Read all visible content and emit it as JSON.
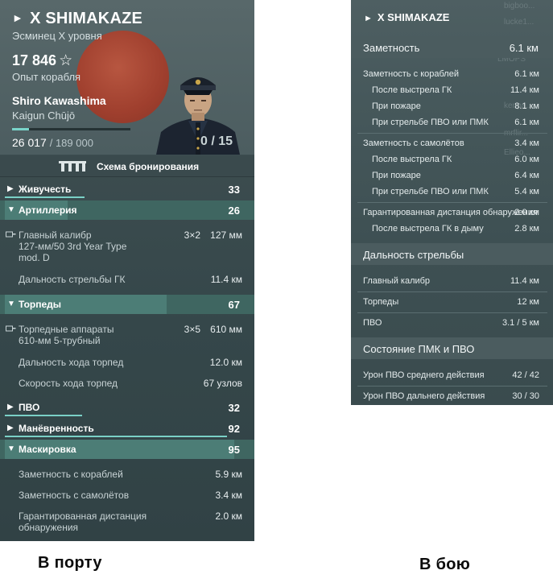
{
  "port": {
    "ship_name": "X SHIMAKAZE",
    "ship_subtitle": "Эсминец X уровня",
    "ship_xp": "17 846",
    "ship_xp_label": "Опыт корабля",
    "commander_name": "Shiro Kawashima",
    "commander_rank": "Kaigun Chūjō",
    "commander_xp": "26 017",
    "commander_xp_max": "/ 189 000",
    "commander_xp_progress": 0.14,
    "commander_skills": "0 / 15",
    "armor_scheme_label": "Схема бронирования",
    "sections": {
      "survivability": {
        "label": "Живучесть",
        "value": "33",
        "progress": 0.33
      },
      "artillery": {
        "label": "Артиллерия",
        "value": "26",
        "progress": 0.26
      },
      "torpedoes": {
        "label": "Торпеды",
        "value": "67",
        "progress": 0.67
      },
      "aa": {
        "label": "ПВО",
        "value": "32",
        "progress": 0.32
      },
      "maneuverability": {
        "label": "Манёвренность",
        "value": "92",
        "progress": 0.92
      },
      "concealment": {
        "label": "Маскировка",
        "value": "95",
        "progress": 0.95
      }
    },
    "artillery": {
      "main_battery_line1": "Главный калибр",
      "main_battery_line2": "127-мм/50 3rd Year Type",
      "main_battery_line3": "mod. D",
      "main_battery_count": "3×2",
      "main_battery_caliber": "127 мм",
      "range_label": "Дальность стрельбы ГК",
      "range_value": "11.4 км"
    },
    "torpedoes": {
      "launchers_line1": "Торпедные аппараты",
      "launchers_line2": "610-мм 5-трубный",
      "launchers_count": "3×5",
      "launchers_caliber": "610 мм",
      "range_label": "Дальность хода торпед",
      "range_value": "12.0 км",
      "speed_label": "Скорость хода торпед",
      "speed_value": "67 узлов"
    },
    "concealment": {
      "by_sea_label": "Заметность с кораблей",
      "by_sea_value": "5.9 км",
      "by_air_label": "Заметность с самолётов",
      "by_air_value": "3.4 км",
      "guaranteed_line1": "Гарантированная дистанция",
      "guaranteed_line2": "обнаружения",
      "guaranteed_value": "2.0 км"
    }
  },
  "battle": {
    "ship_name": "X SHIMAKAZE",
    "ghost_text": [
      "bigboo...",
      "lucke1...",
      "LMOPS",
      "kenpa...",
      "mrflir...",
      "Ellieo..."
    ],
    "detectability": {
      "label": "Заметность",
      "value": "6.1 км"
    },
    "by_ships": {
      "label": "Заметность с кораблей",
      "value": "6.1 км"
    },
    "after_gk": {
      "label": "После выстрела ГК",
      "value": "11.4 км"
    },
    "on_fire": {
      "label": "При пожаре",
      "value": "8.1 км"
    },
    "aa_pmk": {
      "label": "При стрельбе ПВО или ПМК",
      "value": "6.1 км"
    },
    "by_air": {
      "label": "Заметность с самолётов",
      "value": "3.4 км"
    },
    "air_after_gk": {
      "label": "После выстрела ГК",
      "value": "6.0 км"
    },
    "air_on_fire": {
      "label": "При пожаре",
      "value": "6.4 км"
    },
    "air_aa_pmk": {
      "label": "При стрельбе ПВО или ПМК",
      "value": "5.4 км"
    },
    "guaranteed": {
      "label": "Гарантированная дистанция обнаружения",
      "value": "2.0 км"
    },
    "smoke_after_gk": {
      "label": "После выстрела ГК в дыму",
      "value": "2.8 км"
    },
    "range_header": "Дальность стрельбы",
    "main_battery": {
      "label": "Главный калибр",
      "value": "11.4 км"
    },
    "torpedoes": {
      "label": "Торпеды",
      "value": "12 км"
    },
    "aa": {
      "label": "ПВО",
      "value": "3.1 / 5 км"
    },
    "state_header": "Состояние ПМК и ПВО",
    "aa_mid": {
      "label": "Урон ПВО среднего действия",
      "value": "42 / 42"
    },
    "aa_long": {
      "label": "Урон ПВО дальнего действия",
      "value": "30 / 30"
    }
  },
  "captions": {
    "port": "В порту",
    "battle": "В бою"
  },
  "colors": {
    "accent": "#7ad0c6",
    "open_section": "#3f6661",
    "sun": "#a63c29"
  }
}
